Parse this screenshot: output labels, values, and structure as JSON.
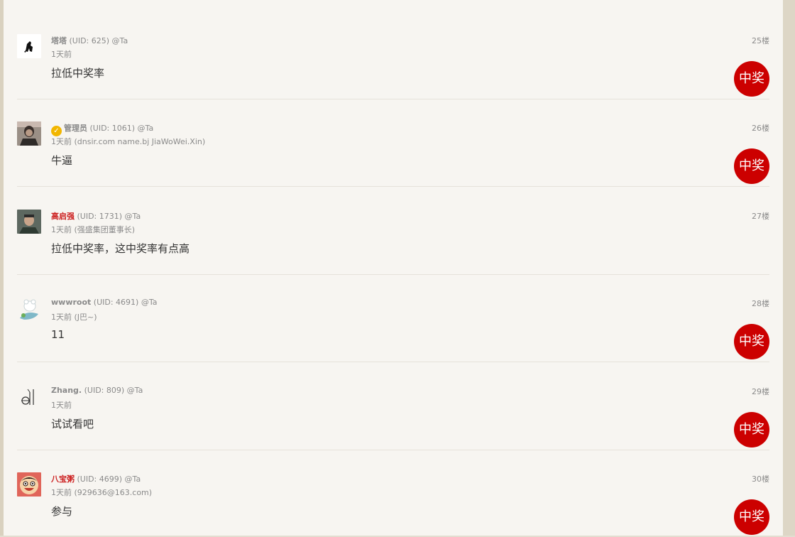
{
  "award_label": "中奖",
  "colors": {
    "award": "#cc0000",
    "admin_name": "#cc1f1f",
    "panel": "#f7f5f1"
  },
  "posts": [
    {
      "name": "塔塔",
      "uid": "(UID: 625)",
      "at": "@Ta",
      "sub": "1天前",
      "content": "拉低中奖率",
      "floor": "25楼",
      "award": true,
      "name_color": "gray",
      "avatar": "ink-horse-avatar"
    },
    {
      "name": "管理员",
      "uid": "(UID: 1061)",
      "at": "@Ta",
      "sub": "1天前 (dnsir.com name.bj JiaWoWei.Xin)",
      "content": "牛逼",
      "floor": "26楼",
      "award": true,
      "name_color": "gray",
      "badge": "verified-badge-icon",
      "avatar": "person-photo-avatar"
    },
    {
      "name": "高启强",
      "uid": "(UID: 1731)",
      "at": "@Ta",
      "sub": "1天前 (强盛集团董事长)",
      "content": "拉低中奖率，这中奖率有点高",
      "floor": "27楼",
      "award": false,
      "name_color": "red",
      "avatar": "man-portrait-avatar"
    },
    {
      "name": "wwwroot",
      "uid": "(UID: 4691)",
      "at": "@Ta",
      "sub": "1天前 (J巴~)",
      "content": "11",
      "floor": "28楼",
      "award": true,
      "name_color": "gray",
      "avatar": "cartoon-bear-avatar"
    },
    {
      "name": "Zhang.",
      "uid": "(UID: 809)",
      "at": "@Ta",
      "sub": "1天前",
      "content": "试试看吧",
      "floor": "29楼",
      "award": true,
      "name_color": "gray",
      "avatar": "line-sketch-avatar"
    },
    {
      "name": "八宝粥",
      "uid": "(UID: 4699)",
      "at": "@Ta",
      "sub": "1天前 (929636@163.com)",
      "content": "参与",
      "floor": "30楼",
      "award": true,
      "name_color": "red",
      "avatar": "smiling-face-avatar"
    }
  ]
}
